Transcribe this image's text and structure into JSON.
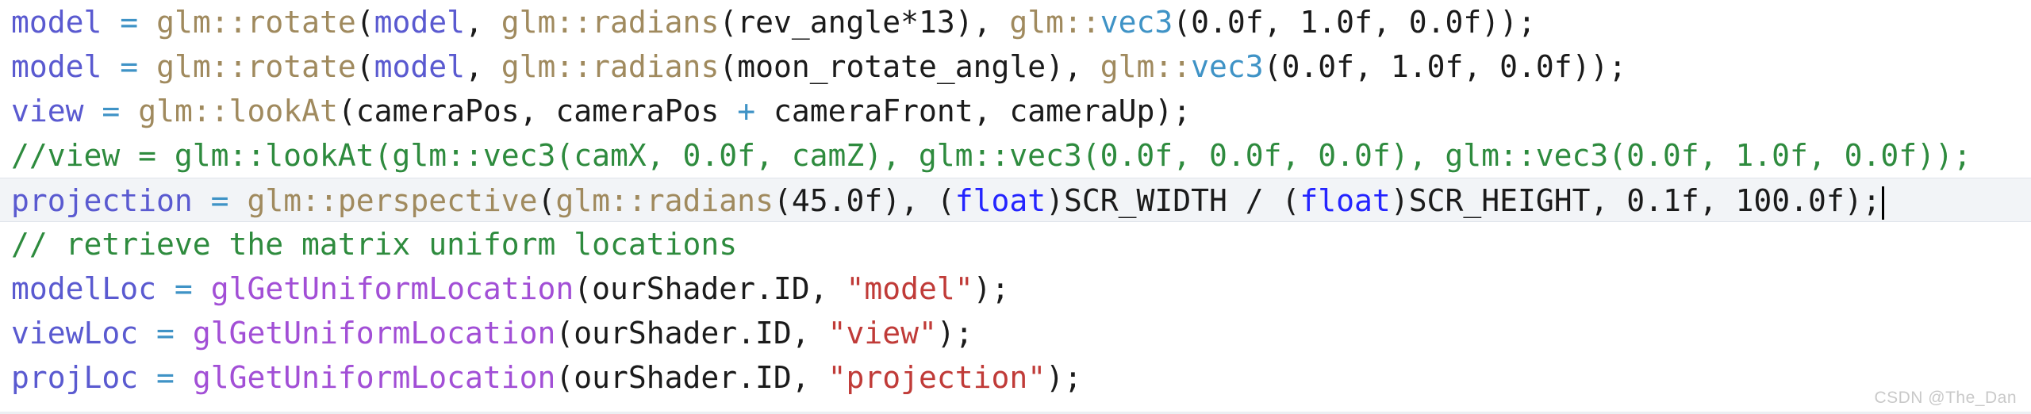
{
  "editor": {
    "language": "C++",
    "watermark": "CSDN @The_Dan",
    "colors": {
      "background": "#ffffff",
      "variable": "#5a5ad0",
      "namespace_function": "#a08a5e",
      "type": "#3f93c6",
      "keyword": "#2424ff",
      "string": "#c03b38",
      "comment": "#2e8b3e",
      "plain": "#1b1b1b",
      "current_line_highlight": "#f2f4f7",
      "watermark_color": "#c9c9c9"
    },
    "current_line_index": 4,
    "caret_line": 4,
    "lines": [
      {
        "index": 0,
        "text": "model = glm::rotate(model, glm::radians(rev_angle*13), glm::vec3(0.0f, 1.0f, 0.0f));",
        "tokens": [
          {
            "t": "model",
            "c": "t-var"
          },
          {
            "t": " ",
            "c": "t-plain"
          },
          {
            "t": "=",
            "c": "t-op"
          },
          {
            "t": " ",
            "c": "t-plain"
          },
          {
            "t": "glm::",
            "c": "t-ns"
          },
          {
            "t": "rotate",
            "c": "t-fn"
          },
          {
            "t": "(",
            "c": "t-plain"
          },
          {
            "t": "model",
            "c": "t-var"
          },
          {
            "t": ", ",
            "c": "t-plain"
          },
          {
            "t": "glm::",
            "c": "t-ns"
          },
          {
            "t": "radians",
            "c": "t-fn"
          },
          {
            "t": "(rev_angle*13), ",
            "c": "t-plain"
          },
          {
            "t": "glm::",
            "c": "t-ns"
          },
          {
            "t": "vec3",
            "c": "t-type"
          },
          {
            "t": "(0.0f, 1.0f, 0.0f));",
            "c": "t-plain"
          }
        ]
      },
      {
        "index": 1,
        "text": "model = glm::rotate(model, glm::radians(moon_rotate_angle), glm::vec3(0.0f, 1.0f, 0.0f));",
        "tokens": [
          {
            "t": "model",
            "c": "t-var"
          },
          {
            "t": " ",
            "c": "t-plain"
          },
          {
            "t": "=",
            "c": "t-op"
          },
          {
            "t": " ",
            "c": "t-plain"
          },
          {
            "t": "glm::",
            "c": "t-ns"
          },
          {
            "t": "rotate",
            "c": "t-fn"
          },
          {
            "t": "(",
            "c": "t-plain"
          },
          {
            "t": "model",
            "c": "t-var"
          },
          {
            "t": ", ",
            "c": "t-plain"
          },
          {
            "t": "glm::",
            "c": "t-ns"
          },
          {
            "t": "radians",
            "c": "t-fn"
          },
          {
            "t": "(moon_rotate_angle), ",
            "c": "t-plain"
          },
          {
            "t": "glm::",
            "c": "t-ns"
          },
          {
            "t": "vec3",
            "c": "t-type"
          },
          {
            "t": "(0.0f, 1.0f, 0.0f));",
            "c": "t-plain"
          }
        ]
      },
      {
        "index": 2,
        "text": "view = glm::lookAt(cameraPos, cameraPos + cameraFront, cameraUp);",
        "tokens": [
          {
            "t": "view",
            "c": "t-var"
          },
          {
            "t": " ",
            "c": "t-plain"
          },
          {
            "t": "=",
            "c": "t-op"
          },
          {
            "t": " ",
            "c": "t-plain"
          },
          {
            "t": "glm::",
            "c": "t-ns"
          },
          {
            "t": "lookAt",
            "c": "t-fn"
          },
          {
            "t": "(cameraPos, cameraPos ",
            "c": "t-plain"
          },
          {
            "t": "+",
            "c": "t-op"
          },
          {
            "t": " cameraFront, cameraUp);",
            "c": "t-plain"
          }
        ]
      },
      {
        "index": 3,
        "text": "//view = glm::lookAt(glm::vec3(camX, 0.0f, camZ), glm::vec3(0.0f, 0.0f, 0.0f), glm::vec3(0.0f, 1.0f, 0.0f));",
        "tokens": [
          {
            "t": "//view = glm::lookAt(glm::vec3(camX, 0.0f, camZ), glm::vec3(0.0f, 0.0f, 0.0f), glm::vec3(0.0f, 1.0f, 0.0f));",
            "c": "t-comment"
          }
        ]
      },
      {
        "index": 4,
        "text": "projection = glm::perspective(glm::radians(45.0f), (float)SCR_WIDTH / (float)SCR_HEIGHT, 0.1f, 100.0f);",
        "tokens": [
          {
            "t": "projection",
            "c": "t-var"
          },
          {
            "t": " ",
            "c": "t-plain"
          },
          {
            "t": "=",
            "c": "t-op"
          },
          {
            "t": " ",
            "c": "t-plain"
          },
          {
            "t": "glm::",
            "c": "t-ns"
          },
          {
            "t": "perspective",
            "c": "t-fn"
          },
          {
            "t": "(",
            "c": "t-plain"
          },
          {
            "t": "glm::",
            "c": "t-ns"
          },
          {
            "t": "radians",
            "c": "t-fn"
          },
          {
            "t": "(45.0f), (",
            "c": "t-plain"
          },
          {
            "t": "float",
            "c": "t-kw"
          },
          {
            "t": ")SCR_WIDTH / (",
            "c": "t-plain"
          },
          {
            "t": "float",
            "c": "t-kw"
          },
          {
            "t": ")SCR_HEIGHT, 0.1f, 100.0f);",
            "c": "t-plain"
          }
        ]
      },
      {
        "index": 5,
        "text": "// retrieve the matrix uniform locations",
        "tokens": [
          {
            "t": "// retrieve the matrix uniform locations",
            "c": "t-comment"
          }
        ]
      },
      {
        "index": 6,
        "text": "modelLoc = glGetUniformLocation(ourShader.ID, \"model\");",
        "tokens": [
          {
            "t": "modelLoc",
            "c": "t-var"
          },
          {
            "t": " ",
            "c": "t-plain"
          },
          {
            "t": "=",
            "c": "t-op"
          },
          {
            "t": " ",
            "c": "t-plain"
          },
          {
            "t": "glGetUniformLocation",
            "c": "t-fnmagenta"
          },
          {
            "t": "(ourShader.ID, ",
            "c": "t-plain"
          },
          {
            "t": "\"model\"",
            "c": "t-str"
          },
          {
            "t": ");",
            "c": "t-plain"
          }
        ]
      },
      {
        "index": 7,
        "text": "viewLoc = glGetUniformLocation(ourShader.ID, \"view\");",
        "tokens": [
          {
            "t": "viewLoc",
            "c": "t-var"
          },
          {
            "t": " ",
            "c": "t-plain"
          },
          {
            "t": "=",
            "c": "t-op"
          },
          {
            "t": " ",
            "c": "t-plain"
          },
          {
            "t": "glGetUniformLocation",
            "c": "t-fnmagenta"
          },
          {
            "t": "(ourShader.ID, ",
            "c": "t-plain"
          },
          {
            "t": "\"view\"",
            "c": "t-str"
          },
          {
            "t": ");",
            "c": "t-plain"
          }
        ]
      },
      {
        "index": 8,
        "text": "projLoc = glGetUniformLocation(ourShader.ID, \"projection\");",
        "tokens": [
          {
            "t": "projLoc",
            "c": "t-var"
          },
          {
            "t": " ",
            "c": "t-plain"
          },
          {
            "t": "=",
            "c": "t-op"
          },
          {
            "t": " ",
            "c": "t-plain"
          },
          {
            "t": "glGetUniformLocation",
            "c": "t-fnmagenta"
          },
          {
            "t": "(ourShader.ID, ",
            "c": "t-plain"
          },
          {
            "t": "\"projection\"",
            "c": "t-str"
          },
          {
            "t": ");",
            "c": "t-plain"
          }
        ]
      }
    ]
  }
}
